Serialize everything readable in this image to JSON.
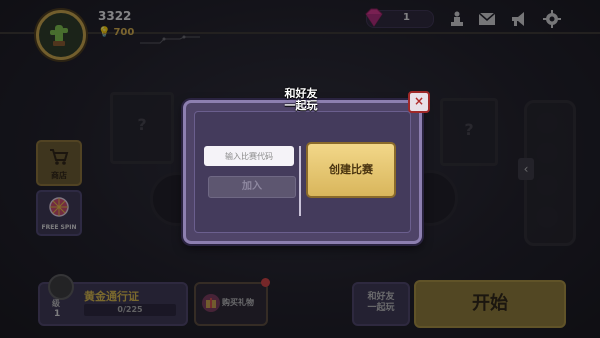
{
  "header": {
    "score": "3322",
    "coins": "700",
    "gems": "1"
  },
  "sidebar": {
    "shop_label": "商店",
    "spin_label": "FREE SPIN"
  },
  "pass": {
    "level_label": "级",
    "level": "1",
    "title": "黄金通行证",
    "progress_text": "0/225",
    "progress_fraction": 0.0
  },
  "footer": {
    "gift_label": "购买礼物",
    "friend_line1": "和好友",
    "friend_line2": "一起玩",
    "start_label": "开始"
  },
  "modal": {
    "title_line1": "和好友",
    "title_line2": "一起玩",
    "close_symbol": "×",
    "code_placeholder": "输入比赛代码",
    "join_label": "加入",
    "create_label": "创建比赛"
  },
  "background": {
    "card_mark": "?"
  },
  "colors": {
    "gold": "#d8b84a",
    "modal_bg": "#4f4468",
    "modal_border": "#8d7fb0",
    "close_red": "#b02c2c",
    "gem_pink": "#d6338a"
  },
  "icons": [
    "cactus-avatar-icon",
    "bulb-icon",
    "gem-icon",
    "trophy-icon",
    "mail-icon",
    "megaphone-icon",
    "gear-icon",
    "cart-icon",
    "wheel-icon",
    "chevron-left-icon",
    "lock-icon",
    "gift-icon",
    "close-icon"
  ]
}
